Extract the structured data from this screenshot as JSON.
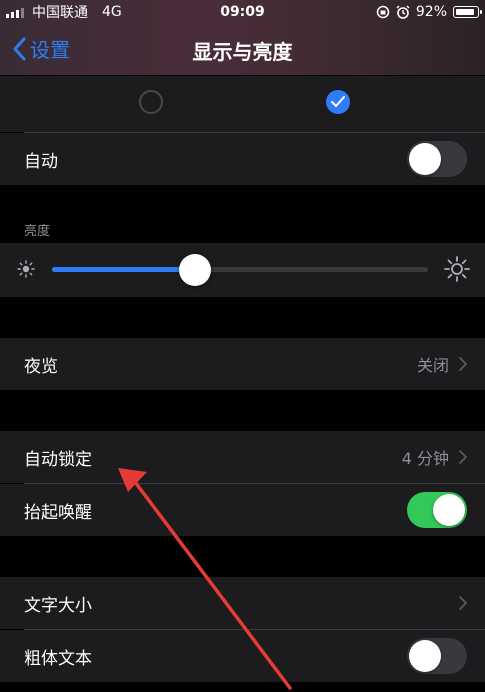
{
  "status": {
    "carrier": "中国联通",
    "network": "4G",
    "time": "09:09",
    "battery": "92%"
  },
  "nav": {
    "back_label": "设置",
    "title": "显示与亮度"
  },
  "appearance": {
    "selected": "dark"
  },
  "auto_row": {
    "label": "自动",
    "on": false
  },
  "brightness": {
    "section_label": "亮度",
    "level_percent": 38
  },
  "night_shift": {
    "label": "夜览",
    "value": "关闭"
  },
  "auto_lock": {
    "label": "自动锁定",
    "value": "4 分钟"
  },
  "raise_to_wake": {
    "label": "抬起唤醒",
    "on": true
  },
  "text_size": {
    "label": "文字大小"
  },
  "bold_text": {
    "label": "粗体文本",
    "on": false
  },
  "colors": {
    "accent": "#2f7df6",
    "toggle_on": "#34c759",
    "row_bg": "#1c1c1e",
    "annotation_arrow": "#e53a36"
  }
}
